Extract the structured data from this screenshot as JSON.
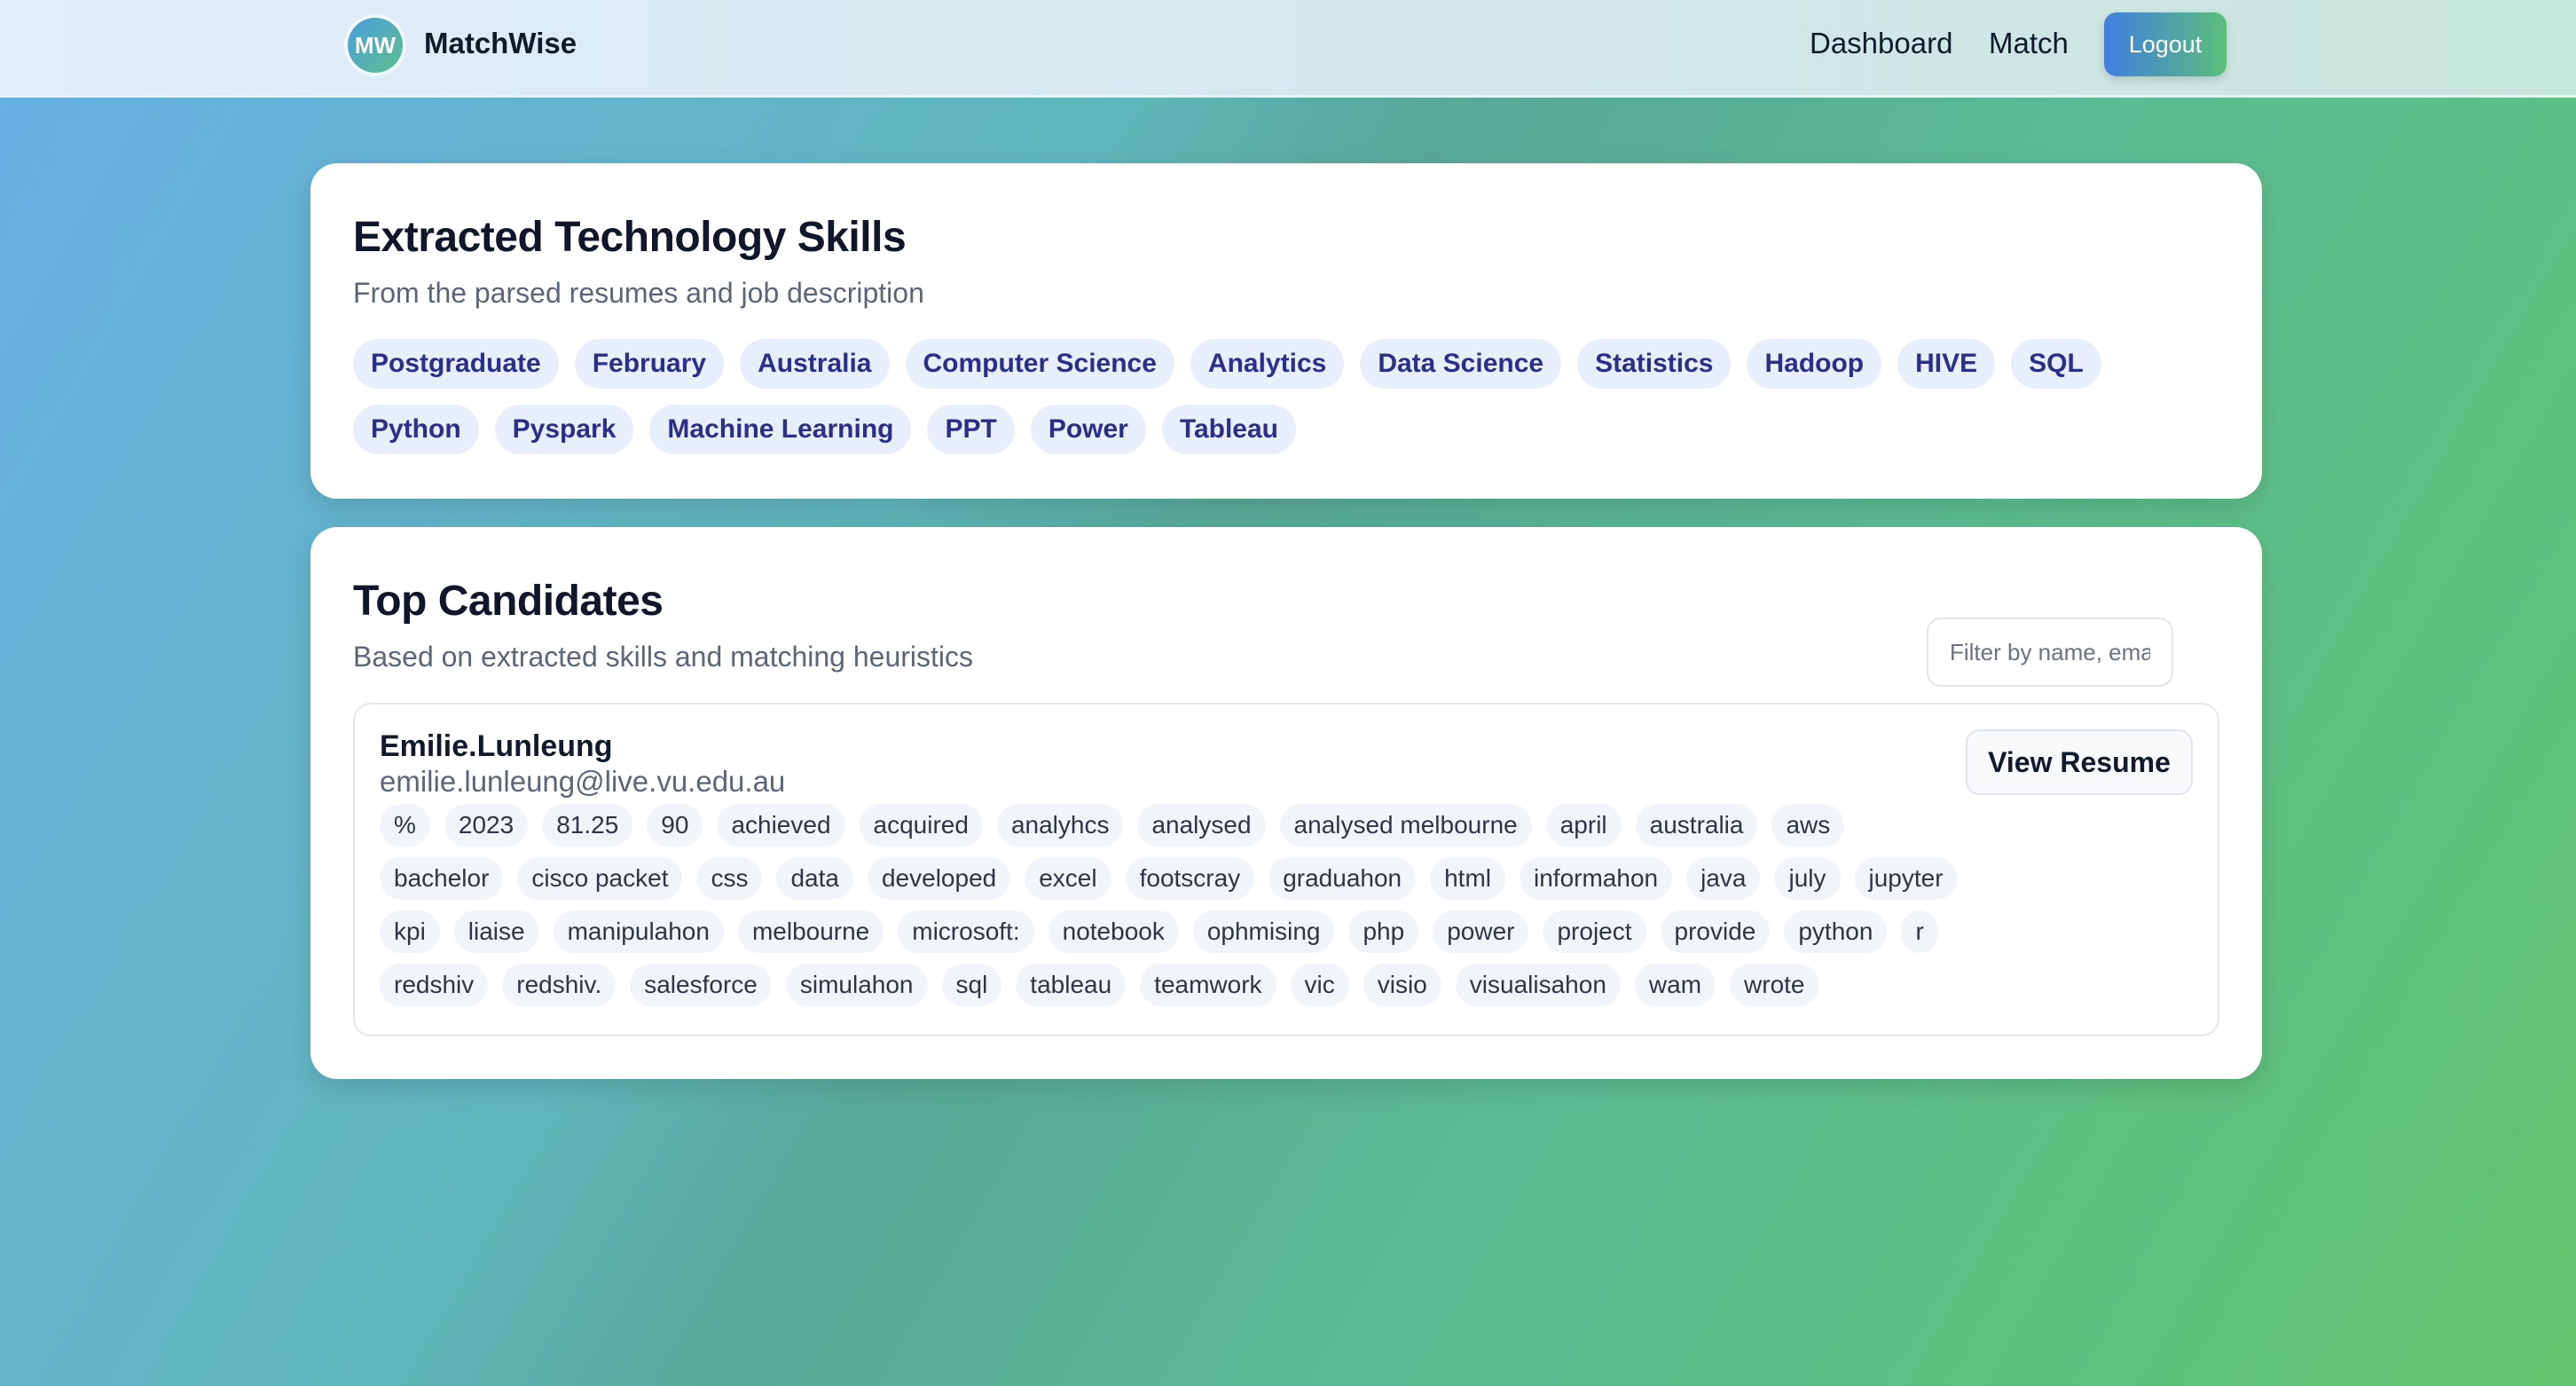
{
  "nav": {
    "logo_text": "MW",
    "brand": "MatchWise",
    "links": [
      "Dashboard",
      "Match"
    ],
    "logout_label": "Logout"
  },
  "skills_card": {
    "title": "Extracted Technology Skills",
    "subtitle": "From the parsed resumes and job description",
    "tags": [
      "Postgraduate",
      "February",
      "Australia",
      "Computer Science",
      "Analytics",
      "Data Science",
      "Statistics",
      "Hadoop",
      "HIVE",
      "SQL",
      "Python",
      "Pyspark",
      "Machine Learning",
      "PPT",
      "Power",
      "Tableau"
    ]
  },
  "candidates_card": {
    "title": "Top Candidates",
    "subtitle": "Based on extracted skills and matching heuristics",
    "filter_placeholder": "Filter by name, email, o",
    "candidates": [
      {
        "name": "Emilie.Lunleung",
        "email": "emilie.lunleung@live.vu.edu.au",
        "view_label": "View Resume",
        "tags": [
          "%",
          "2023",
          "81.25",
          "90",
          "achieved",
          "acquired",
          "analyhcs",
          "analysed",
          "analysed melbourne",
          "april",
          "australia",
          "aws",
          "bachelor",
          "cisco packet",
          "css",
          "data",
          "developed",
          "excel",
          "footscray",
          "graduahon",
          "html",
          "informahon",
          "java",
          "july",
          "jupyter",
          "kpi",
          "liaise",
          "manipulahon",
          "melbourne",
          "microsoft:",
          "notebook",
          "ophmising",
          "php",
          "power",
          "project",
          "provide",
          "python",
          "r",
          "redshiv",
          "redshiv.",
          "salesforce",
          "simulahon",
          "sql",
          "tableau",
          "teamwork",
          "vic",
          "visio",
          "visualisahon",
          "wam",
          "wrote"
        ]
      }
    ]
  },
  "colors": {
    "accent_start": "#3f7fe0",
    "accent_end": "#5bbf79",
    "skill_tag_text": "#2a2e8c",
    "skill_tag_bg": "#e9effa"
  }
}
